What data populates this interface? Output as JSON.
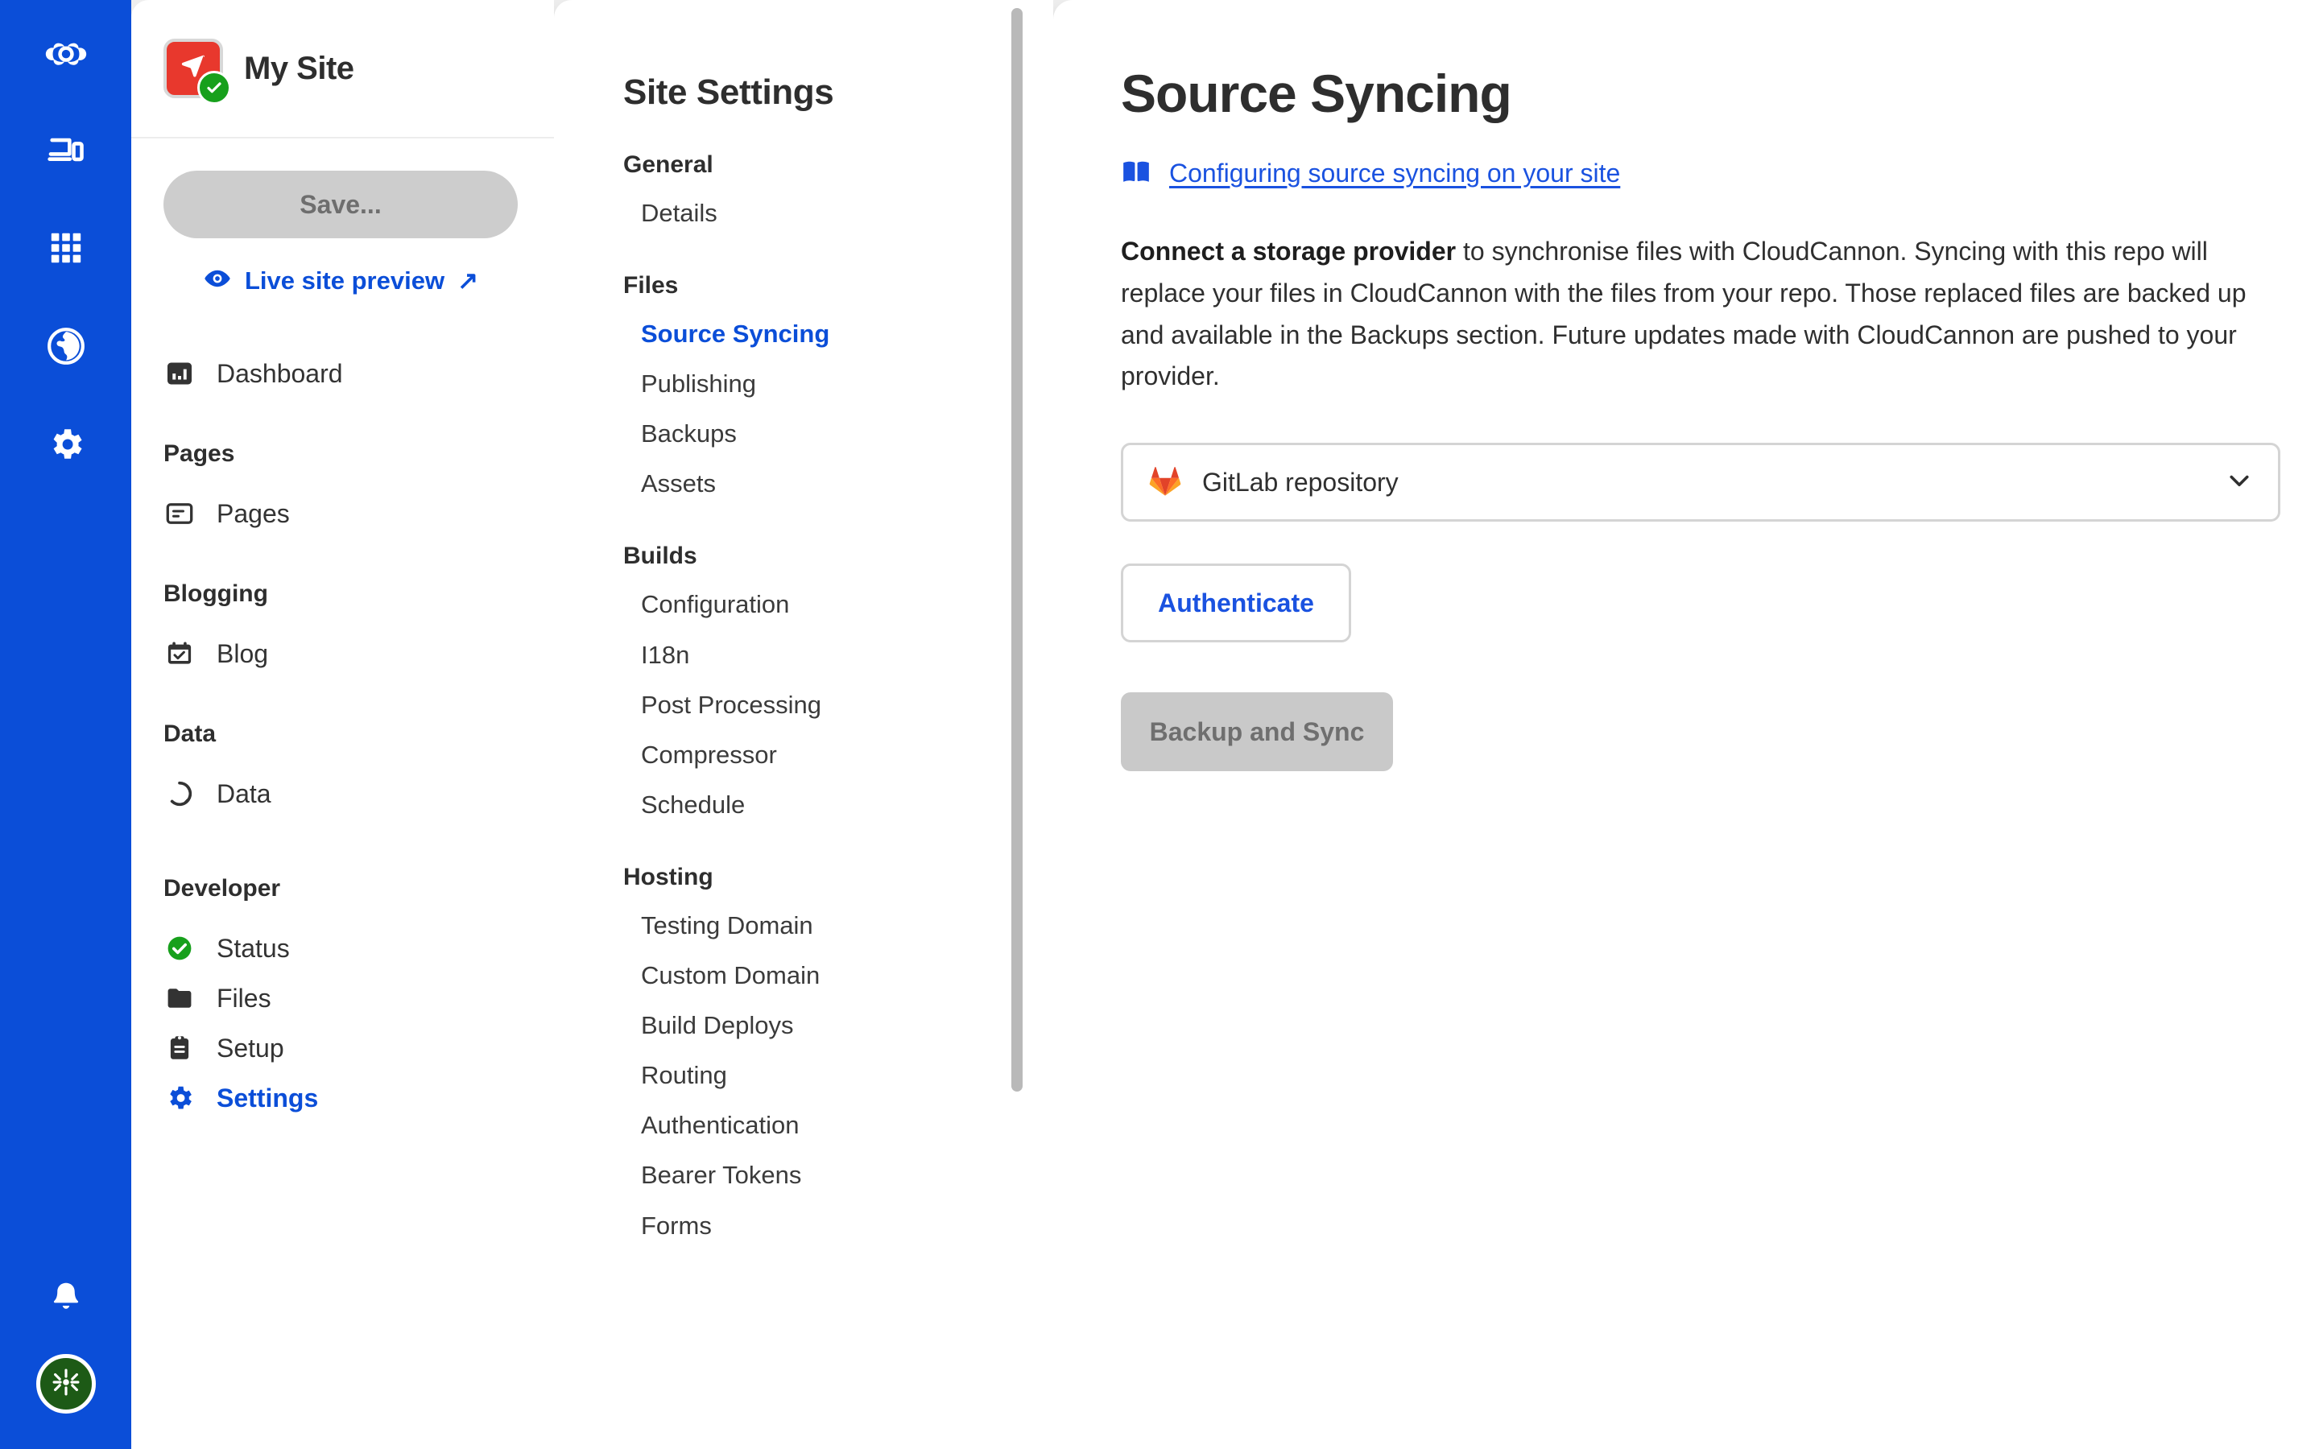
{
  "theme": {
    "brand_blue": "#0b4ed8",
    "link_blue": "#1a52e0",
    "site_avatar_red": "#e8382d",
    "status_green": "#17a01c",
    "avatar_green": "#1d5a16",
    "disabled_gray": "#c9c9c9"
  },
  "rail": {
    "logo_icon": "cloudcannon-logo-icon",
    "items": [
      {
        "icon": "devices-icon",
        "name": "rail-item-devices"
      },
      {
        "icon": "grid-apps-icon",
        "name": "rail-item-apps"
      },
      {
        "icon": "globe-icon",
        "name": "rail-item-globe"
      },
      {
        "icon": "gear-icon",
        "name": "rail-item-settings"
      }
    ],
    "bottom": [
      {
        "icon": "bell-icon",
        "name": "rail-item-notifications"
      },
      {
        "icon": "user-avatar-icon",
        "name": "rail-item-account"
      }
    ]
  },
  "sidebar": {
    "site_name": "My Site",
    "site_icon": "cursor-paper-plane-icon",
    "site_status_icon": "check-circle-icon",
    "save_label": "Save...",
    "preview_label": "Live site preview",
    "preview_icon": "eye-icon",
    "preview_external_glyph": "↗",
    "dashboard": {
      "label": "Dashboard",
      "icon": "bar-chart-icon"
    },
    "groups": [
      {
        "title": "Pages",
        "items": [
          {
            "label": "Pages",
            "icon": "page-icon"
          }
        ]
      },
      {
        "title": "Blogging",
        "items": [
          {
            "label": "Blog",
            "icon": "calendar-check-icon"
          }
        ]
      },
      {
        "title": "Data",
        "items": [
          {
            "label": "Data",
            "icon": "circle-dashed-icon"
          }
        ]
      },
      {
        "title": "Developer",
        "items": [
          {
            "label": "Status",
            "icon": "status-check-icon"
          },
          {
            "label": "Files",
            "icon": "folder-icon"
          },
          {
            "label": "Setup",
            "icon": "clipboard-icon"
          },
          {
            "label": "Settings",
            "icon": "gear-icon",
            "active": true
          }
        ]
      }
    ]
  },
  "settings_nav": {
    "title": "Site Settings",
    "groups": [
      {
        "title": "General",
        "items": [
          {
            "label": "Details"
          }
        ]
      },
      {
        "title": "Files",
        "items": [
          {
            "label": "Source Syncing",
            "active": true
          },
          {
            "label": "Publishing"
          },
          {
            "label": "Backups"
          },
          {
            "label": "Assets"
          }
        ]
      },
      {
        "title": "Builds",
        "items": [
          {
            "label": "Configuration"
          },
          {
            "label": "I18n"
          },
          {
            "label": "Post Processing"
          },
          {
            "label": "Compressor"
          },
          {
            "label": "Schedule"
          }
        ]
      },
      {
        "title": "Hosting",
        "items": [
          {
            "label": "Testing Domain"
          },
          {
            "label": "Custom Domain"
          },
          {
            "label": "Build Deploys"
          },
          {
            "label": "Routing"
          },
          {
            "label": "Authentication"
          },
          {
            "label": "Bearer Tokens"
          },
          {
            "label": "Forms"
          }
        ]
      }
    ]
  },
  "main": {
    "title": "Source Syncing",
    "doc_icon": "book-icon",
    "doc_link": "Configuring source syncing on your site",
    "intro_bold": "Connect a storage provider",
    "intro_rest": " to synchronise files with CloudCannon. Syncing with this repo will replace your files in CloudCannon with the files from your repo. Those replaced files are backed up and available in the Backups section. Future updates made with CloudCannon are pushed to your provider.",
    "provider": {
      "selected": "GitLab repository",
      "icon": "gitlab-icon",
      "chevron_icon": "chevron-down-icon"
    },
    "authenticate_label": "Authenticate",
    "sync_label": "Backup and Sync"
  }
}
